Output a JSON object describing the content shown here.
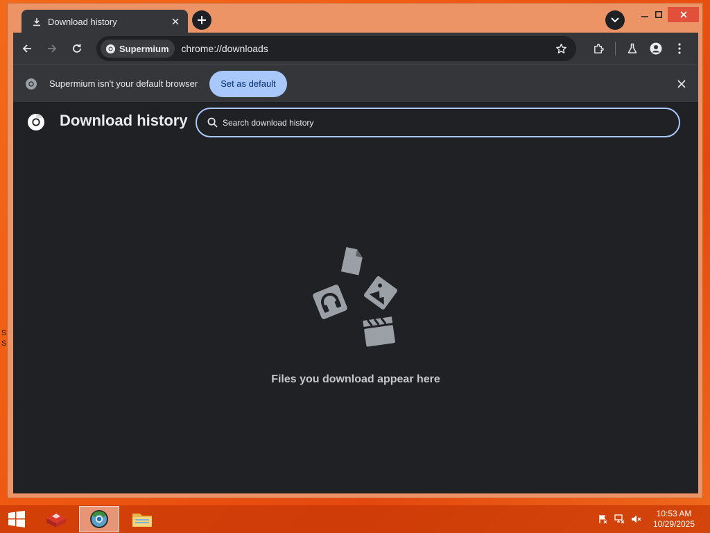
{
  "desktop": {
    "frag1": "S",
    "frag2": "S"
  },
  "browser": {
    "tab": {
      "title": "Download history",
      "icon": "download-icon"
    },
    "window_controls": {
      "minimize": "–",
      "maximize": "□",
      "close": "✕"
    },
    "toolbar": {
      "site_chip": "Supermium",
      "url": "chrome://downloads"
    },
    "infobar": {
      "message": "Supermium isn't your default browser",
      "button_label": "Set as default"
    }
  },
  "page": {
    "title": "Download history",
    "search_placeholder": "Search download history",
    "empty_message": "Files you download appear here"
  },
  "taskbar": {
    "time": "10:53 AM",
    "date": "10/29/2025"
  },
  "colors": {
    "accent": "#a8c7fa",
    "page_bg": "#202124",
    "toolbar_bg": "#35363a",
    "desktop": "#ef5a12"
  }
}
